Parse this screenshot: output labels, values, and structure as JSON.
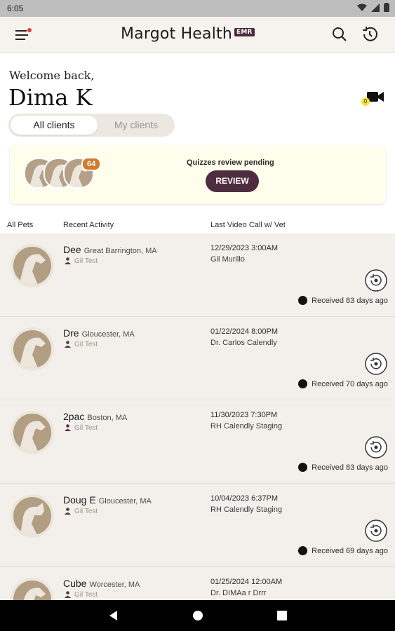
{
  "status_bar": {
    "time": "6:05"
  },
  "app": {
    "brand": "Margot Health",
    "badge": "EMR"
  },
  "welcome": {
    "greeting": "Welcome back,",
    "name": "Dima K",
    "video_badge_count": "0"
  },
  "segmented": {
    "all": "All clients",
    "mine": "My clients"
  },
  "quiz_card": {
    "count": "64",
    "text": "Quizzes review pending",
    "button": "REVIEW"
  },
  "table_headers": {
    "pets": "All Pets",
    "activity": "Recent Activity",
    "last_call": "Last Video Call w/ Vet"
  },
  "pets": [
    {
      "name": "Dee",
      "location": "Great Barrington, MA",
      "owner": "Gil Test",
      "call_date": "12/29/2023  3:00AM",
      "vet": "Gil Murillo",
      "received": "Received 83 days ago"
    },
    {
      "name": "Dre",
      "location": "Gloucester, MA",
      "owner": "Gil Test",
      "call_date": "01/22/2024  8:00PM",
      "vet": "Dr. Carlos Calendly",
      "received": "Received 70 days ago"
    },
    {
      "name": "2pac",
      "location": "Boston, MA",
      "owner": "Gil Test",
      "call_date": "11/30/2023  7:30PM",
      "vet": "RH Calendly Staging",
      "received": "Received 83 days ago"
    },
    {
      "name": "Doug E",
      "location": "Gloucester, MA",
      "owner": "Gil Test",
      "call_date": "10/04/2023  6:37PM",
      "vet": "RH Calendly Staging",
      "received": "Received 69 days ago"
    },
    {
      "name": "Cube",
      "location": "Worcester, MA",
      "owner": "Gil Test",
      "call_date": "01/25/2024  12:00AM",
      "vet": "Dr. DIMAa r Drrr",
      "received": ""
    }
  ],
  "colors": {
    "brand": "#4f2d40",
    "accent_orange": "#d47a2c",
    "avatar_tan": "#b19e83",
    "card_yellow": "#fffdeb"
  },
  "icons": {
    "menu": "menu-icon",
    "search": "search-icon",
    "history": "history-icon",
    "video": "video-camera-icon",
    "replay": "replay-icon",
    "person": "person-icon"
  }
}
